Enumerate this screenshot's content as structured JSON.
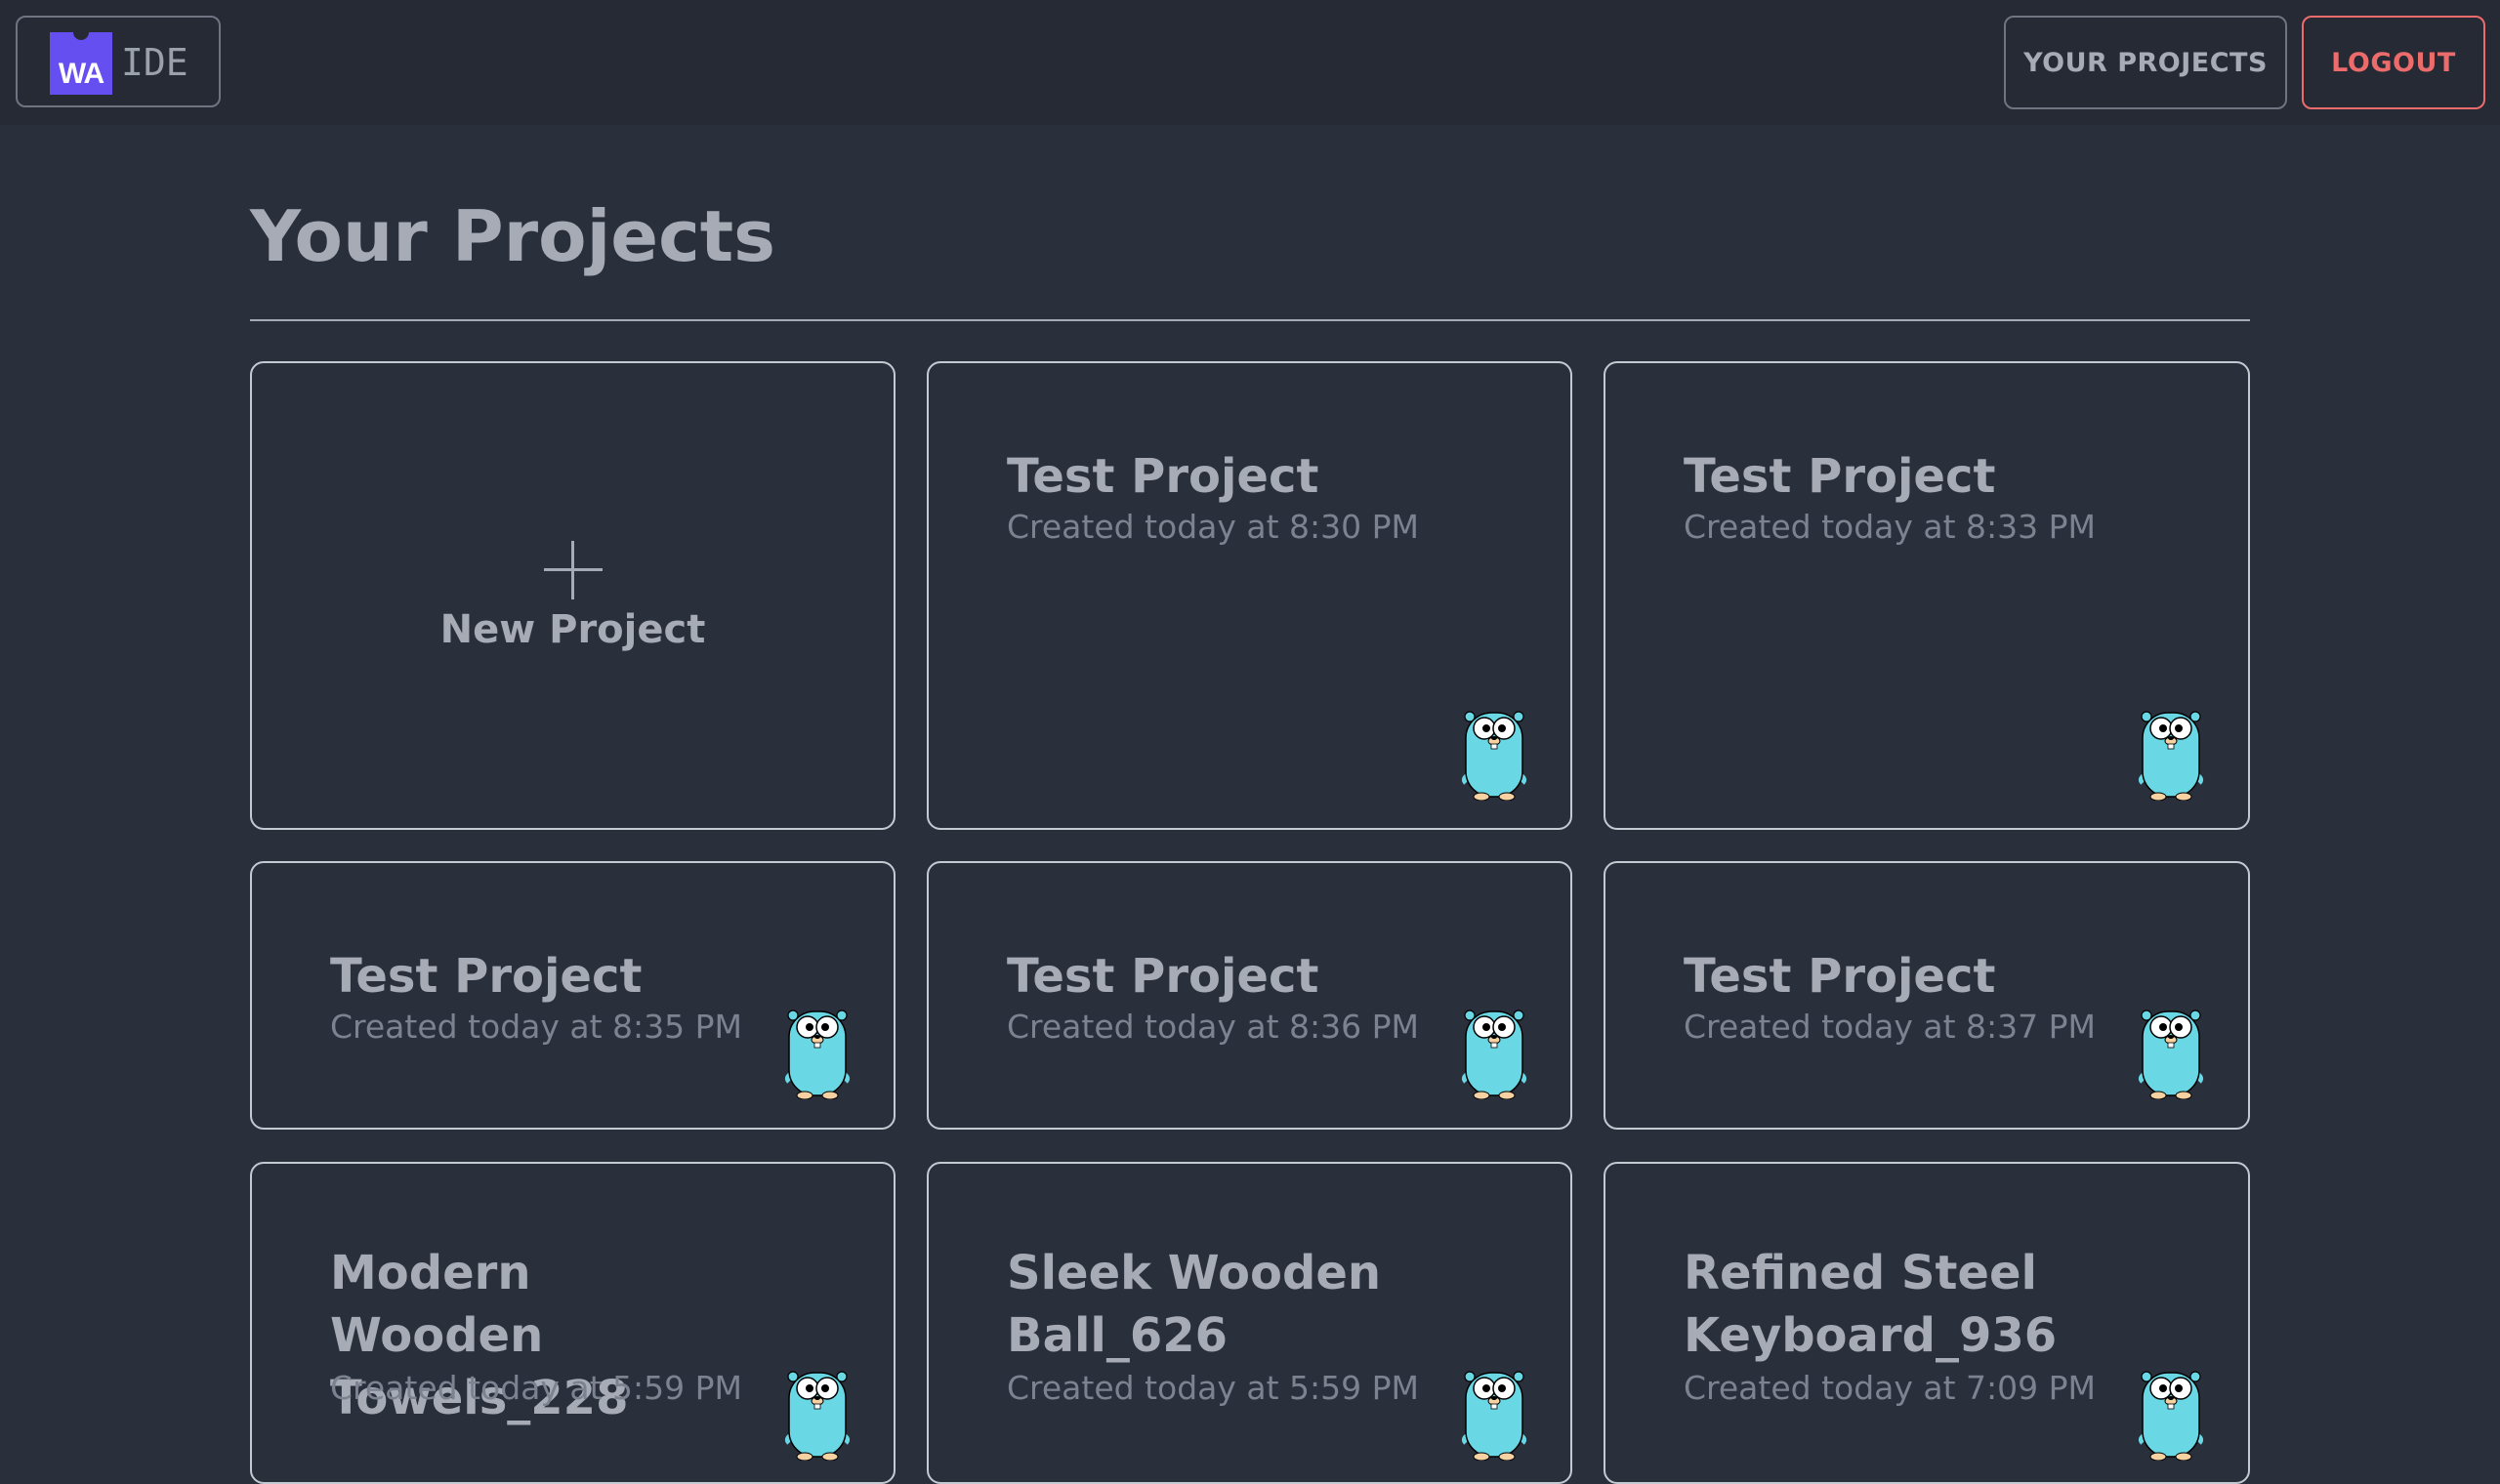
{
  "app": {
    "badge_text": "WA",
    "title_suffix": "IDE"
  },
  "nav": {
    "projects_label": "YOUR PROJECTS",
    "logout_label": "LOGOUT",
    "logout_color": "#ec6b6b"
  },
  "page": {
    "title": "Your Projects"
  },
  "new_project": {
    "label": "New Project",
    "icon": "plus-icon"
  },
  "projects": [
    {
      "title": "Test Project",
      "created": "Created today at 8:30 PM",
      "icon": "gopher-icon"
    },
    {
      "title": "Test Project",
      "created": "Created today at 8:33 PM",
      "icon": "gopher-icon"
    },
    {
      "title": "Test Project",
      "created": "Created today at 8:35 PM",
      "icon": "gopher-icon"
    },
    {
      "title": "Test Project",
      "created": "Created today at 8:36 PM",
      "icon": "gopher-icon"
    },
    {
      "title": "Test Project",
      "created": "Created today at 8:37 PM",
      "icon": "gopher-icon"
    },
    {
      "title": "Modern Wooden Towels_228",
      "created": "Created today at 5:59 PM",
      "icon": "gopher-icon"
    },
    {
      "title": "Sleek Wooden Ball_626",
      "created": "Created today at 5:59 PM",
      "icon": "gopher-icon"
    },
    {
      "title": "Refined Steel Keyboard_936",
      "created": "Created today at 7:09 PM",
      "icon": "gopher-icon"
    }
  ],
  "colors": {
    "background": "#2a2f3c",
    "topbar": "#252a35",
    "brand": "#654ff0",
    "gopher": "#6ad7e5"
  }
}
